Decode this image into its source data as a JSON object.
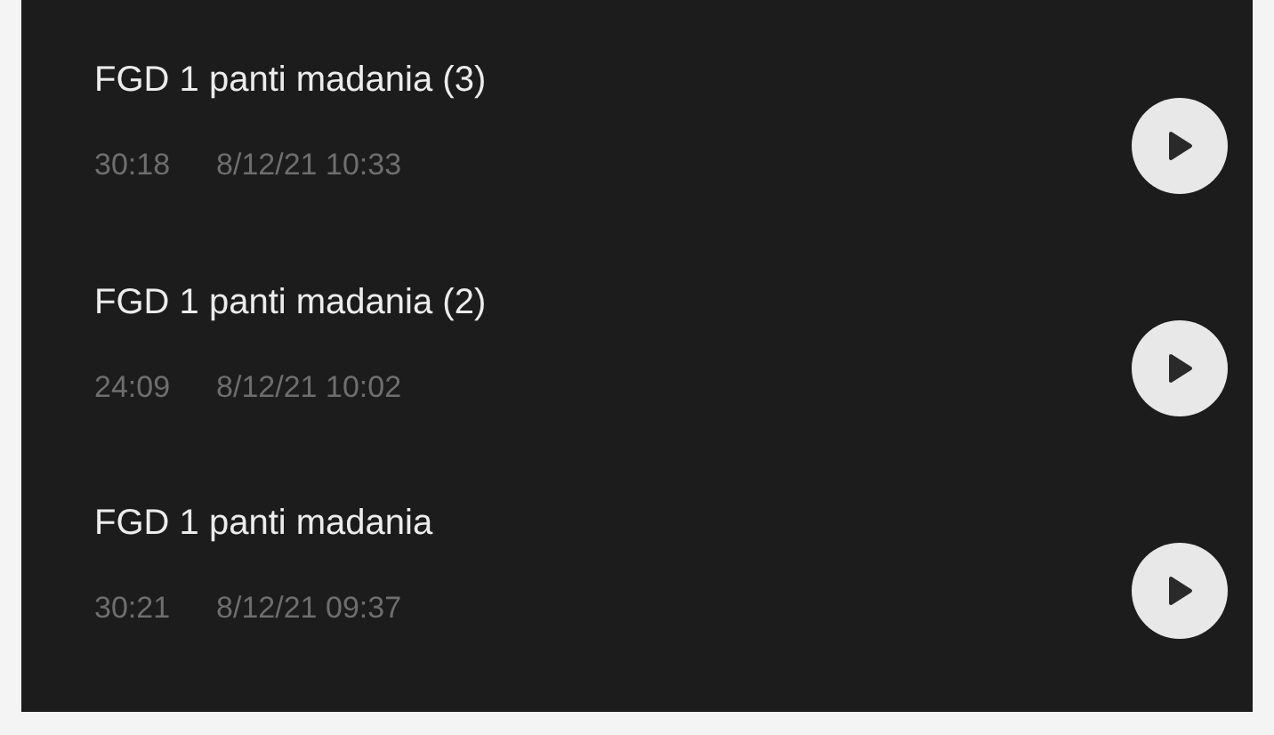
{
  "recordings": [
    {
      "title": "FGD 1 panti madania (3)",
      "duration": "30:18",
      "date": "8/12/21 10:33"
    },
    {
      "title": "FGD 1 panti madania (2)",
      "duration": "24:09",
      "date": "8/12/21 10:02"
    },
    {
      "title": "FGD 1 panti madania",
      "duration": "30:21",
      "date": "8/12/21 09:37"
    }
  ]
}
